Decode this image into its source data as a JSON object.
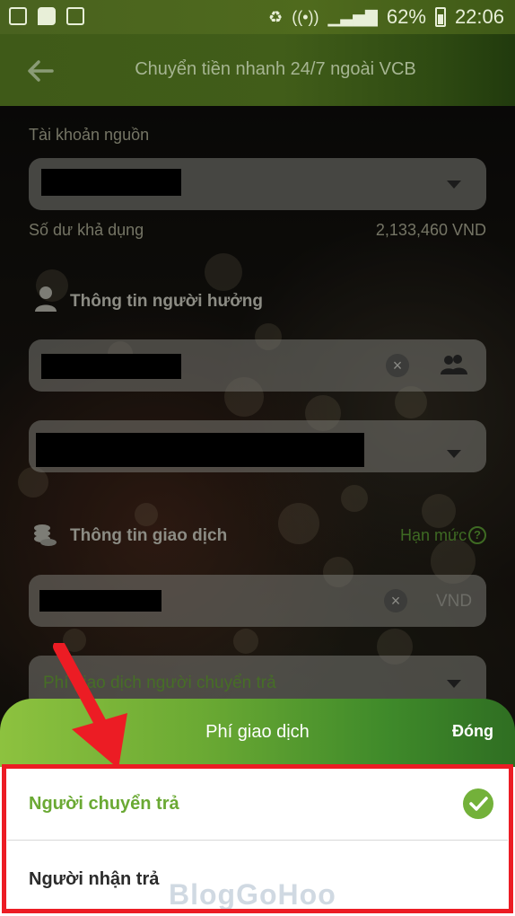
{
  "status_bar": {
    "battery": "62%",
    "time": "22:06",
    "icons": [
      "gallery-icon",
      "message-icon",
      "sim-icon",
      "battery-saver-icon",
      "wifi-icon",
      "signal-icon",
      "battery-icon"
    ]
  },
  "header": {
    "title": "Chuyển tiền nhanh 24/7 ngoài VCB",
    "back_icon": "arrow-left-icon"
  },
  "source_account": {
    "label": "Tài khoản nguồn",
    "balance_label": "Số dư khả dụng",
    "balance_value": "2,133,460 VND"
  },
  "beneficiary": {
    "section_title": "Thông tin người hưởng",
    "clear_icon": "×"
  },
  "transaction": {
    "section_title": "Thông tin giao dịch",
    "limit_link": "Hạn mức",
    "help_icon": "?",
    "currency": "VND",
    "clear_icon": "×",
    "fee_field_value": "Phí giao dịch người chuyển trả"
  },
  "fee_sheet": {
    "title": "Phí giao dịch",
    "close_label": "Đóng",
    "options": [
      {
        "label": "Người chuyển trả",
        "selected": true
      },
      {
        "label": "Người nhận trả",
        "selected": false
      }
    ]
  },
  "watermark": "BlogGoHoo",
  "colors": {
    "accent": "#6aa933",
    "highlight": "#ec1c24",
    "header_green": "#415d19"
  }
}
